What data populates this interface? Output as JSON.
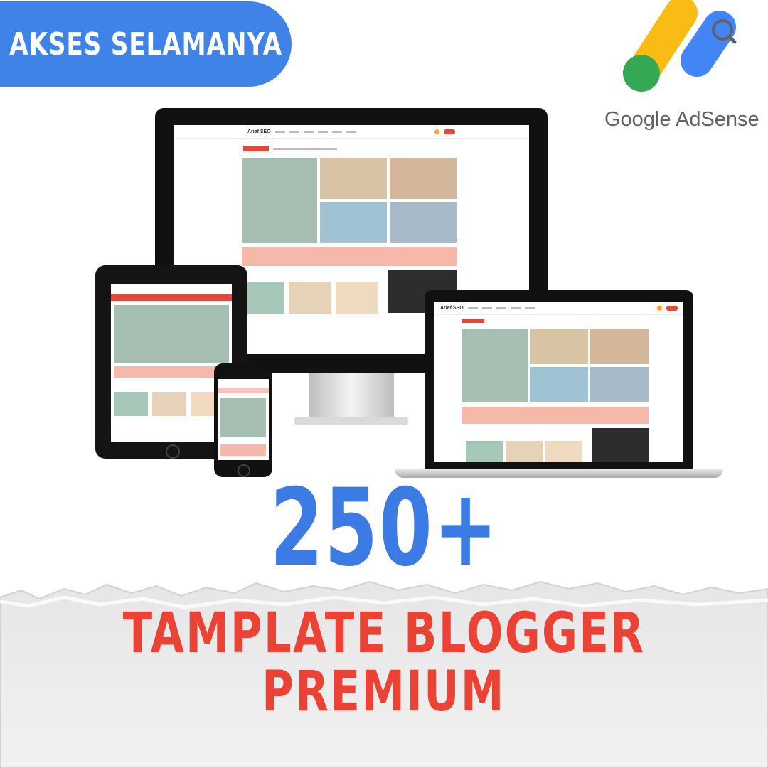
{
  "badge": {
    "label": "AKSES SELAMANYA",
    "color": "#3f83e6"
  },
  "adsense": {
    "brand": "Google AdSense",
    "icon": "google-adsense-logo"
  },
  "promo": {
    "count": "250+",
    "headline_line1": "TAMPLATE BLOGGER",
    "headline_line2": "PREMIUM"
  },
  "mockup": {
    "site_name": "Arief SEO",
    "devices": [
      "desktop-monitor",
      "tablet",
      "smartphone",
      "laptop"
    ]
  },
  "colors": {
    "blue": "#3b7be3",
    "red": "#ea4335",
    "google_yellow": "#f9bc15",
    "google_green": "#34a853",
    "google_blue": "#4285f4"
  }
}
